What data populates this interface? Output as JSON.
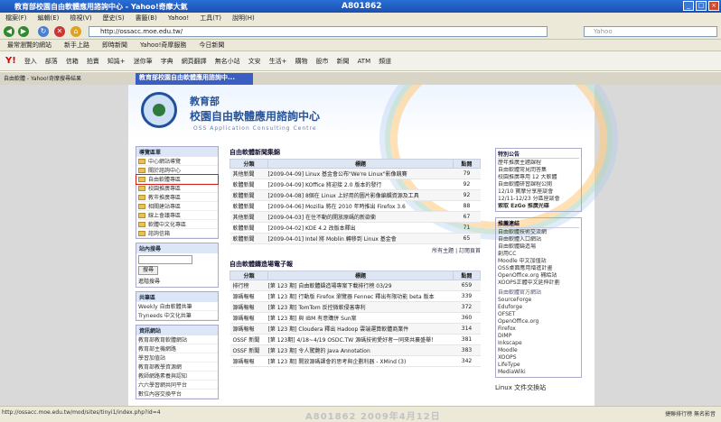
{
  "window": {
    "title": "教育部校園自由軟體應用諮詢中心 - Yahoo!奇摩大氣",
    "tag": "A801862"
  },
  "menu": [
    "檔案(F)",
    "編輯(E)",
    "檢視(V)",
    "歷史(S)",
    "書籤(B)",
    "Yahoo!",
    "工具(T)",
    "說明(H)"
  ],
  "address": {
    "url": "http://ossacc.moe.edu.tw/",
    "search_placeholder": "Yahoo"
  },
  "bookmarks": [
    "最常瀏覽的網站",
    "新手上路",
    "即時新聞",
    "Yahoo!奇摩服務",
    "今日新聞"
  ],
  "yahoo_toolbar": {
    "logo": "Y!",
    "items": [
      "登入",
      "部落",
      "信箱",
      "拍賣",
      "知識+",
      "迷你筆",
      "字典",
      "網頁翻譯",
      "無名小站",
      "文安",
      "生活+",
      "購物",
      "股市",
      "新聞",
      "ATM",
      "頻道"
    ]
  },
  "tabs": {
    "first": "自由軟體 - Yahoo!奇摩搜尋結果",
    "active": "教育部校園自由軟體應用諮詢中..."
  },
  "banner": {
    "org": "教育部",
    "center": "校園自由軟體應用諮詢中心",
    "en": "OSS Application Consulting Centre"
  },
  "left": {
    "nav_title": "導覽區單",
    "nav": [
      "中心網站導覽",
      "關於諮詢中心",
      "自由軟體專區",
      "校園推廣專區",
      "教市推廣專區",
      "相關建站專區",
      "線上會議專區",
      "軟體中文化專區",
      "諮詢信箱"
    ],
    "search_title": "站內搜尋",
    "search_button": "搜尋",
    "search_adv": "進階搜尋",
    "share_title": "共筆區",
    "share": [
      "Weekly 自由軟體共筆",
      "Tryneeds 中文化共筆"
    ],
    "res_title": "資訊網站",
    "res": [
      "教育部教育軟體網站",
      "教育部主機網路",
      "學習加值站",
      "教育部教學資源網",
      "教師網路素養與認知",
      "六六學習網共同平台",
      "數位內容交換平台"
    ]
  },
  "news": {
    "title": "自由軟體新聞集錦",
    "headers": [
      "分類",
      "標題",
      "點閱"
    ],
    "rows": [
      {
        "cat": "其他新聞",
        "title": "[2009-04-09] Linux 基金會公布\"We're Linux\"影像競賽",
        "hits": "79"
      },
      {
        "cat": "軟體新聞",
        "title": "[2009-04-09] KOffice 將迎接 2.0 版本的發行",
        "hits": "92"
      },
      {
        "cat": "軟體新聞",
        "title": "[2009-04-08] 8個在 Linux 上好用的圖片影像編輯資源及工具",
        "hits": "92"
      },
      {
        "cat": "軟體新聞",
        "title": "[2009-04-06] Mozilla 將在 2010 年時推出 Firefox 3.6",
        "hits": "88"
      },
      {
        "cat": "其他新聞",
        "title": "[2009-04-03] 在住不動的開放原碼的新欲衝",
        "hits": "67"
      },
      {
        "cat": "軟體新聞",
        "title": "[2009-04-02] KDE 4.2 改版本釋出",
        "hits": "71"
      },
      {
        "cat": "軟體新聞",
        "title": "[2009-04-01] Intel 將 Moblin 轉移到 Linux 基金會",
        "hits": "65"
      }
    ],
    "more": "所有主題 | 訂閱頁首"
  },
  "epaper": {
    "title": "自由軟體鑄造場電子報",
    "headers": [
      "分類",
      "標題",
      "點閱"
    ],
    "rows": [
      {
        "cat": "排行榜",
        "title": "[第 123 期] 自由軟體鑄造場專案下載排行榜 03/29",
        "hits": "659"
      },
      {
        "cat": "源碼報報",
        "title": "[第 123 期] 行動版 Firefox 瀏覽器 Fennec 釋出有限功能 beta 版本",
        "hits": "339"
      },
      {
        "cat": "源碼報報",
        "title": "[第 123 期] TomTom 反控微軟侵害專利",
        "hits": "372"
      },
      {
        "cat": "源碼報報",
        "title": "[第 123 期] 與 IBM 有意購併 Sun案",
        "hits": "360"
      },
      {
        "cat": "源碼報報",
        "title": "[第 123 期] Cloudera 釋出 Hadoop 雲端運算軟體商業件",
        "hits": "314"
      },
      {
        "cat": "OSSF 新聞",
        "title": "[第 123期] 4/18~4/19 OSDC.TW 源碼技術愛好者一同來共襄盛舉！",
        "hits": "381"
      },
      {
        "cat": "OSSF 新聞",
        "title": "[第 123 期] 令人驚艷的 Java Annotation",
        "hits": "383"
      },
      {
        "cat": "源碼報報",
        "title": "[第 123 期] 開放源碼課會的思考與企劃利器 - XMind (3)",
        "hits": "342"
      }
    ]
  },
  "right": {
    "announce_title": "特別公告",
    "announce": [
      "歷年推廣主題課程",
      "自由軟體常見問答集",
      "校園推廣專用 12 大軟體",
      "自由軟體研習課程公開",
      "12/10 寶摩分享座談會",
      "12/11-12/23 分區座談會",
      "索取 EzGo 推廣光碟"
    ],
    "links_title": "推薦連結",
    "links": [
      "自由軟體技術交流網",
      "自由軟體入口網站",
      "自由軟體鑄造場",
      "創用CC",
      "Moodle 中文加值站",
      "OSS桌面應用增進計畫",
      "OpenOffice.org 補給站",
      "XOOPS正體中文延伸計劃"
    ],
    "group_title": "自由軟體官方網站",
    "group": [
      "SourceForge",
      "Eduforge",
      "OFSET",
      "OpenOffice.org",
      "Firefox",
      "DIMP",
      "Inkscape",
      "Moodle",
      "XOOPS",
      "LifeType",
      "MediaWiki"
    ],
    "extra": "Linux 文件交換站"
  },
  "status": {
    "url": "http://ossacc.moe.edu.tw/mod/sites/tinyi1/index.php?id=4",
    "watermark": "A801862  2009年4月12日",
    "right": "捷聯排行榜  無名影音"
  }
}
